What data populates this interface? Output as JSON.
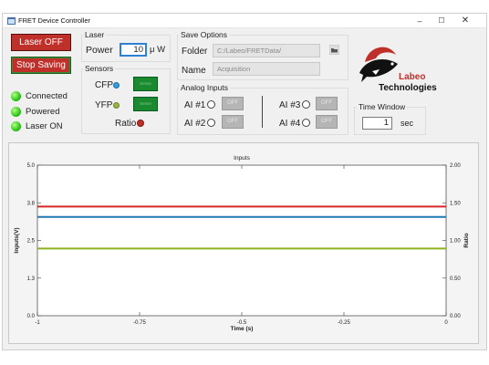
{
  "window": {
    "title": "FRET Device Controller",
    "min_glyph": "–",
    "max_glyph": "☐",
    "close_glyph": "✕"
  },
  "controls": {
    "laser_button": "Laser OFF",
    "saving_button": "Stop Saving"
  },
  "status": [
    {
      "label": "Connected",
      "color": "#2dc416"
    },
    {
      "label": "Powered",
      "color": "#2dc416"
    },
    {
      "label": "Laser ON",
      "color": "#2dc416"
    }
  ],
  "laser": {
    "title": "Laser",
    "power_label": "Power",
    "power_value": "10",
    "power_unit": "μ W"
  },
  "sensors": {
    "title": "Sensors",
    "cfp_label": "CFP",
    "cfp_color": "#3a9ad9",
    "yfp_label": "YFP",
    "yfp_color": "#9bb34a",
    "ratio_label": "Ratio",
    "ratio_color": "#c0302b",
    "cfp_button": "Sense",
    "yfp_button": "Sense"
  },
  "save_options": {
    "title": "Save Options",
    "folder_label": "Folder",
    "folder_value": "C:/Labeo/FRETData/",
    "name_label": "Name",
    "name_value": "Acquisition"
  },
  "analog_inputs": {
    "title": "Analog Inputs",
    "inputs": [
      {
        "label": "AI #1",
        "button": "OFF"
      },
      {
        "label": "AI #2",
        "button": "OFF"
      },
      {
        "label": "AI #3",
        "button": "OFF"
      },
      {
        "label": "AI #4",
        "button": "OFF"
      }
    ]
  },
  "time_window": {
    "title": "Time Window",
    "value": "1",
    "unit": "sec"
  },
  "logo": {
    "line1": "Labeo",
    "line2": "Technologies"
  },
  "chart_data": {
    "type": "line",
    "title": "Inputs",
    "xlabel": "Time (s)",
    "ylabel": "Inputs(V)",
    "y2label": "Ratio",
    "xlim": [
      -1,
      0
    ],
    "ylim": [
      0,
      5
    ],
    "y2lim": [
      0,
      2
    ],
    "x_ticks": [
      "-1",
      "-0.75",
      "-0.5",
      "-0.25",
      "0"
    ],
    "y_ticks": [
      "0.0",
      "1.3",
      "2.5",
      "3.8",
      "5.0"
    ],
    "y2_ticks": [
      "0.00",
      "0.50",
      "1.00",
      "1.50",
      "2.00"
    ],
    "grid": false,
    "series": [
      {
        "color": "#d62728",
        "axis": "right",
        "x": [
          -1,
          0
        ],
        "values": [
          1.45,
          1.45
        ]
      },
      {
        "color": "#1f77b4",
        "axis": "left",
        "x": [
          -1,
          0
        ],
        "values": [
          3.28,
          3.28
        ]
      },
      {
        "color": "#8cb21e",
        "axis": "left",
        "x": [
          -1,
          0
        ],
        "values": [
          2.23,
          2.23
        ]
      }
    ]
  }
}
